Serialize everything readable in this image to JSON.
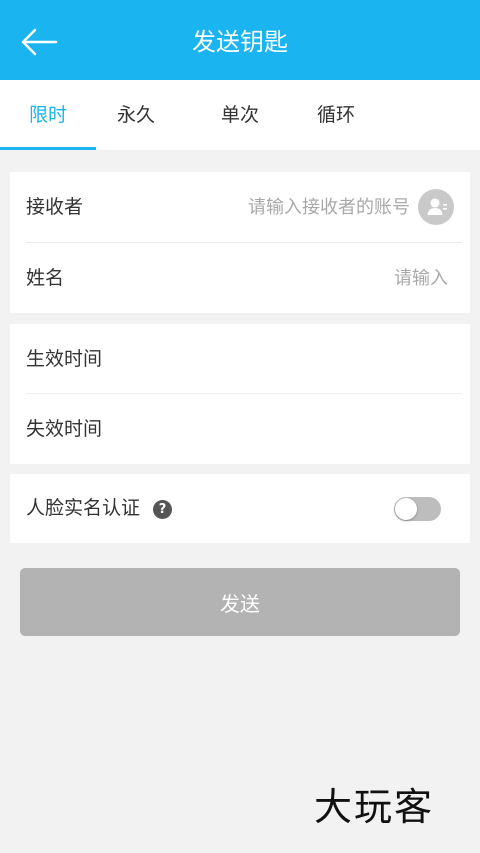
{
  "colors": {
    "accent": "#1ab4f0",
    "background": "#f2f2f2",
    "disabled_button": "#b3b3b3",
    "toggle_off": "#bdbdbd"
  },
  "appbar": {
    "back_icon": "arrow-left-icon",
    "title": "发送钥匙"
  },
  "tabs": [
    {
      "label": "限时",
      "active": true
    },
    {
      "label": "永久",
      "active": false
    },
    {
      "label": "单次",
      "active": false
    },
    {
      "label": "循环",
      "active": false
    }
  ],
  "recipient_card": {
    "receiver": {
      "label": "接收者",
      "value": "",
      "placeholder": "请输入接收者的账号",
      "icon": "contact-person-icon"
    },
    "name": {
      "label": "姓名",
      "value": "",
      "placeholder": "请输入"
    }
  },
  "time_card": {
    "effective_label": "生效时间",
    "expire_label": "失效时间"
  },
  "face_card": {
    "label": "人脸实名认证",
    "help_icon": "question-circle-icon",
    "help_glyph": "?",
    "toggle_on": false
  },
  "send_button": {
    "label": "发送",
    "enabled": false
  },
  "watermark": {
    "text": "大玩客"
  }
}
